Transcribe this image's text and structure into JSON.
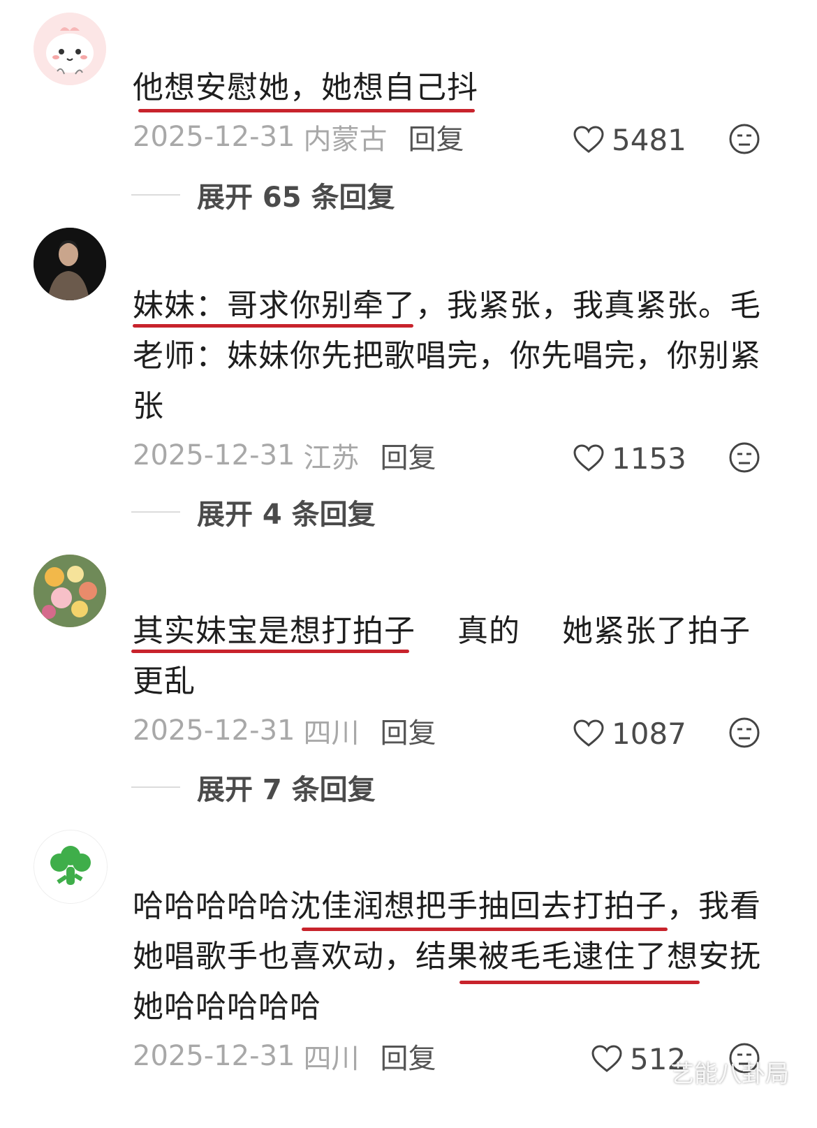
{
  "comments": [
    {
      "text": "他想安慰她，她想自己抖",
      "date": "2025-12-31",
      "location": "内蒙古",
      "reply_label": "回复",
      "likes": "5481",
      "expand_label": "展开 65 条回复"
    },
    {
      "text": "妹妹：哥求你别牵了，我紧张，我真紧张。毛老师：妹妹你先把歌唱完，你先唱完，你别紧张",
      "date": "2025-12-31",
      "location": "江苏",
      "reply_label": "回复",
      "likes": "1153",
      "expand_label": "展开 4 条回复"
    },
    {
      "text": "其实妹宝是想打拍子　 真的　 她紧张了拍子更乱",
      "date": "2025-12-31",
      "location": "四川",
      "reply_label": "回复",
      "likes": "1087",
      "expand_label": "展开 7 条回复"
    },
    {
      "text": "哈哈哈哈哈沈佳润想把手抽回去打拍子，我看她唱歌手也喜欢动，结果被毛毛逮住了想安抚她哈哈哈哈哈",
      "date": "2025-12-31",
      "location": "四川",
      "reply_label": "回复",
      "likes": "512",
      "expand_label": ""
    }
  ],
  "watermark": "艺能八卦局",
  "colors": {
    "underline": "#c8232c",
    "meta_text": "#a8a8a8",
    "body_text": "#1e1e1e"
  },
  "icons": [
    "heart-outline-icon",
    "neutral-face-emoji-icon"
  ]
}
